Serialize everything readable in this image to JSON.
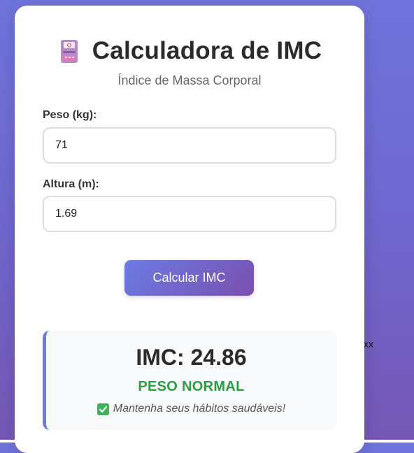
{
  "app": {
    "title": "Calculadora de IMC",
    "subtitle": "Índice de Massa Corporal",
    "icon": "medical-clipboard-icon"
  },
  "form": {
    "weight_label": "Peso (kg):",
    "weight_value": "71",
    "height_label": "Altura (m):",
    "height_value": "1.69",
    "button_label": "Calcular IMC"
  },
  "result": {
    "imc_text": "IMC: 24.86",
    "imc_value": 24.86,
    "category": "PESO NORMAL",
    "advice": "Mantenha seus hábitos saudáveis!",
    "advice_icon": "check-mark-icon"
  },
  "stray_text": "xx",
  "colors": {
    "accent_start": "#6b7ce5",
    "accent_end": "#7a4fae",
    "status_green": "#2e9e45",
    "check_green": "#3cb55a"
  }
}
